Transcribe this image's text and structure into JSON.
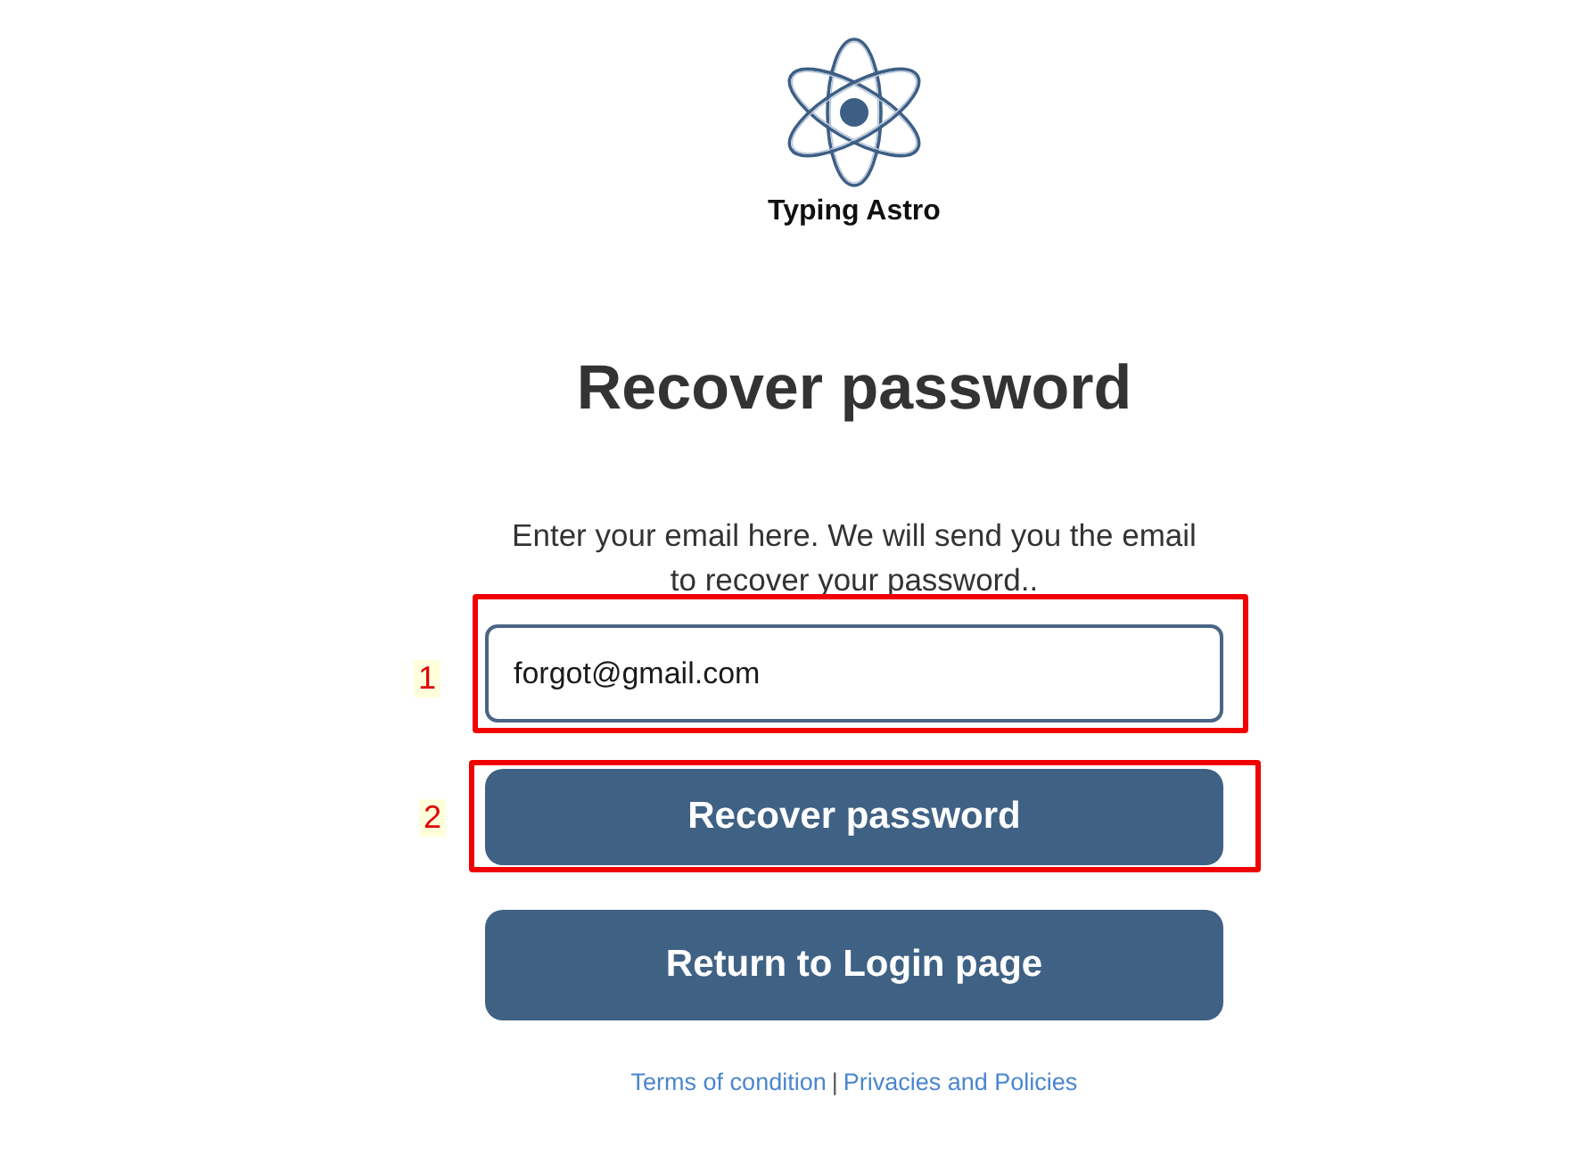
{
  "logo": {
    "name": "Typing Astro"
  },
  "heading": "Recover password",
  "description": "Enter your email here. We will send you the email to recover your password..",
  "email_field": {
    "value": "forgot@gmail.com"
  },
  "buttons": [
    {
      "label": "Recover password"
    },
    {
      "label": "Return to Login page"
    }
  ],
  "footer": {
    "links": [
      "Terms of condition",
      "Privacies and Policies"
    ],
    "separator": "|"
  },
  "annotations": [
    {
      "label": "1"
    },
    {
      "label": "2"
    }
  ]
}
